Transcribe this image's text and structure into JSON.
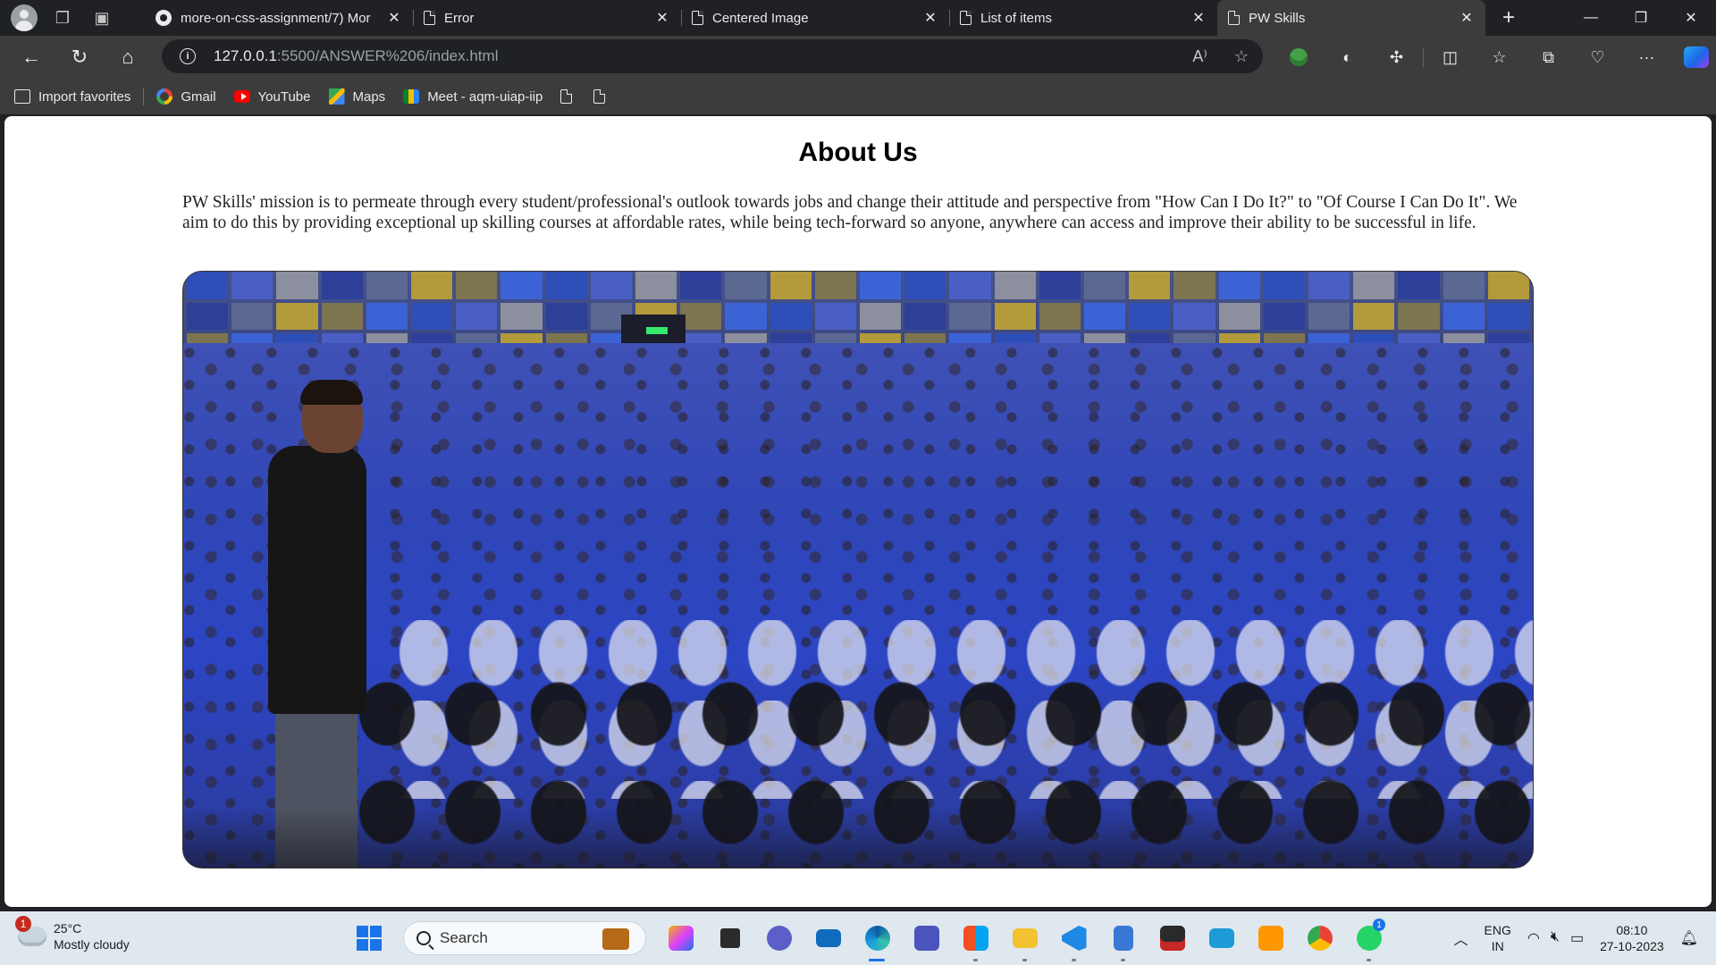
{
  "browser": {
    "tabs": [
      {
        "title": "more-on-css-assignment/7) Mor",
        "icon": "github-icon",
        "active": false
      },
      {
        "title": "Error",
        "icon": "document-icon",
        "active": false
      },
      {
        "title": "Centered Image",
        "icon": "document-icon",
        "active": false
      },
      {
        "title": "List of items",
        "icon": "document-icon",
        "active": false
      },
      {
        "title": "PW Skills",
        "icon": "document-icon",
        "active": true
      }
    ],
    "url_host": "127.0.0.1",
    "url_rest": ":5500/ANSWER%206/index.html",
    "favorites": [
      {
        "label": "Import favorites",
        "icon": "import-icon"
      },
      {
        "label": "Gmail",
        "icon": "google-icon"
      },
      {
        "label": "YouTube",
        "icon": "youtube-icon"
      },
      {
        "label": "Maps",
        "icon": "maps-icon"
      },
      {
        "label": "Meet - aqm-uiap-iip",
        "icon": "meet-icon"
      }
    ]
  },
  "page": {
    "title": "About Us",
    "paragraph": "PW Skills' mission is to permeate through every student/professional's outlook towards jobs and change their attitude and perspective from \"How Can I Do It?\" to \"Of Course I Can Do It\". We aim to do this by providing exceptional up skilling courses at affordable rates, while being tech-forward so anyone, anywhere can access and improve their ability to be successful in life.",
    "image": "auditorium-photo"
  },
  "taskbar": {
    "weather_badge": "1",
    "temperature": "25°C",
    "weather_desc": "Mostly cloudy",
    "search_label": "Search",
    "whatsapp_badge": "1",
    "language_top": "ENG",
    "language_bottom": "IN",
    "time": "08:10",
    "date": "27-10-2023"
  },
  "colors": {
    "tabbar": "#202124",
    "toolbar": "#3c3c3c",
    "page_bg": "#ffffff",
    "taskbar": "#dfe8ee",
    "accent": "#1a73e8"
  }
}
